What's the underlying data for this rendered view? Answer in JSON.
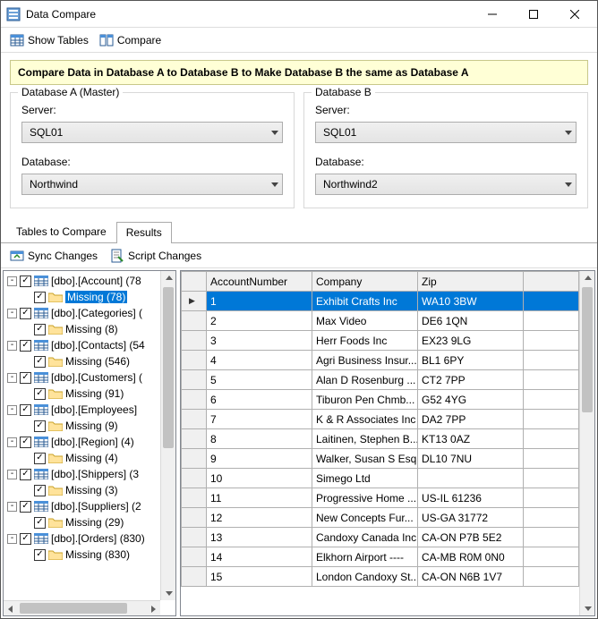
{
  "window": {
    "title": "Data Compare"
  },
  "toolbar": {
    "show_tables": "Show Tables",
    "compare": "Compare"
  },
  "banner": "Compare Data in Database A to Database B to Make Database B the same as Database A",
  "dbA": {
    "legend": "Database A (Master)",
    "server_label": "Server:",
    "server_value": "SQL01",
    "database_label": "Database:",
    "database_value": "Northwind"
  },
  "dbB": {
    "legend": "Database B",
    "server_label": "Server:",
    "server_value": "SQL01",
    "database_label": "Database:",
    "database_value": "Northwind2"
  },
  "tabs": {
    "tables_to_compare": "Tables to Compare",
    "results": "Results"
  },
  "results_toolbar": {
    "sync": "Sync Changes",
    "script": "Script Changes"
  },
  "tree": [
    {
      "level": 1,
      "twist": "-",
      "icon": "table",
      "label": "[dbo].[Account] (78"
    },
    {
      "level": 2,
      "twist": "",
      "icon": "folder",
      "label": "Missing (78)",
      "selected": true
    },
    {
      "level": 1,
      "twist": "-",
      "icon": "table",
      "label": "[dbo].[Categories] ("
    },
    {
      "level": 2,
      "twist": "",
      "icon": "folder",
      "label": "Missing (8)"
    },
    {
      "level": 1,
      "twist": "-",
      "icon": "table",
      "label": "[dbo].[Contacts] (54"
    },
    {
      "level": 2,
      "twist": "",
      "icon": "folder",
      "label": "Missing (546)"
    },
    {
      "level": 1,
      "twist": "-",
      "icon": "table",
      "label": "[dbo].[Customers] ("
    },
    {
      "level": 2,
      "twist": "",
      "icon": "folder",
      "label": "Missing (91)"
    },
    {
      "level": 1,
      "twist": "-",
      "icon": "table",
      "label": "[dbo].[Employees] "
    },
    {
      "level": 2,
      "twist": "",
      "icon": "folder",
      "label": "Missing (9)"
    },
    {
      "level": 1,
      "twist": "-",
      "icon": "table",
      "label": "[dbo].[Region] (4)"
    },
    {
      "level": 2,
      "twist": "",
      "icon": "folder",
      "label": "Missing (4)"
    },
    {
      "level": 1,
      "twist": "-",
      "icon": "table",
      "label": "[dbo].[Shippers] (3"
    },
    {
      "level": 2,
      "twist": "",
      "icon": "folder",
      "label": "Missing (3)"
    },
    {
      "level": 1,
      "twist": "-",
      "icon": "table",
      "label": "[dbo].[Suppliers] (2"
    },
    {
      "level": 2,
      "twist": "",
      "icon": "folder",
      "label": "Missing (29)"
    },
    {
      "level": 1,
      "twist": "-",
      "icon": "table",
      "label": "[dbo].[Orders] (830)"
    },
    {
      "level": 2,
      "twist": "",
      "icon": "folder",
      "label": "Missing (830)"
    }
  ],
  "grid": {
    "columns": [
      "AccountNumber",
      "Company",
      "Zip"
    ],
    "rows": [
      {
        "acc": "1",
        "company": "Exhibit Crafts Inc",
        "zip": "WA10 3BW",
        "selected": true
      },
      {
        "acc": "2",
        "company": "Max Video",
        "zip": "DE6 1QN"
      },
      {
        "acc": "3",
        "company": "Herr Foods Inc",
        "zip": "EX23 9LG"
      },
      {
        "acc": "4",
        "company": "Agri Business Insur...",
        "zip": "BL1 6PY"
      },
      {
        "acc": "5",
        "company": "Alan D Rosenburg ...",
        "zip": "CT2 7PP"
      },
      {
        "acc": "6",
        "company": "Tiburon Pen Chmb...",
        "zip": "G52 4YG"
      },
      {
        "acc": "7",
        "company": "K & R Associates Inc",
        "zip": "DA2 7PP"
      },
      {
        "acc": "8",
        "company": "Laitinen, Stephen B...",
        "zip": "KT13 0AZ"
      },
      {
        "acc": "9",
        "company": "Walker, Susan S Esq",
        "zip": "DL10 7NU"
      },
      {
        "acc": "10",
        "company": "Simego Ltd",
        "zip": ""
      },
      {
        "acc": "11",
        "company": "Progressive Home ...",
        "zip": "US-IL 61236"
      },
      {
        "acc": "12",
        "company": "New Concepts Fur...",
        "zip": "US-GA 31772"
      },
      {
        "acc": "13",
        "company": "Candoxy Canada Inc.",
        "zip": "CA-ON P7B 5E2"
      },
      {
        "acc": "14",
        "company": "Elkhorn Airport ----",
        "zip": "CA-MB R0M 0N0"
      },
      {
        "acc": "15",
        "company": "London Candoxy St...",
        "zip": "CA-ON N6B 1V7"
      }
    ]
  }
}
